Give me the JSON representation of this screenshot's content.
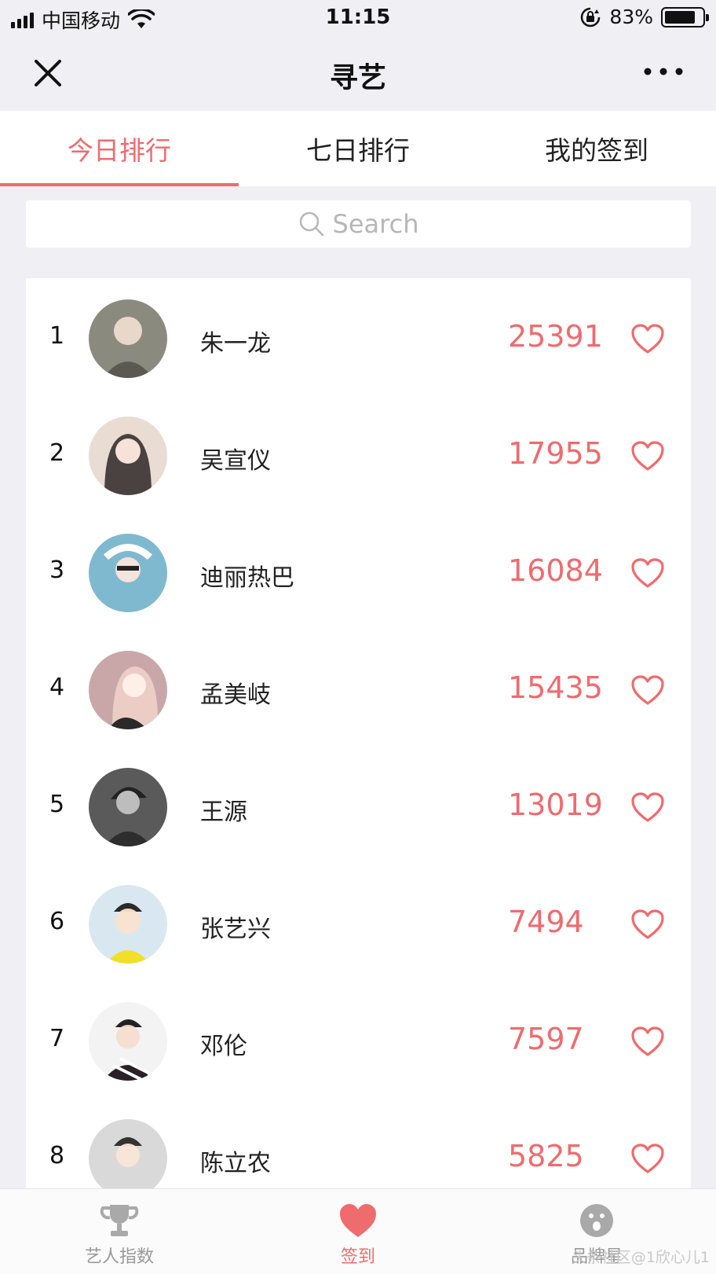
{
  "status_bar": {
    "carrier": "中国移动",
    "time": "11:15",
    "battery_percent": "83%",
    "battery_level": 0.83
  },
  "nav": {
    "title": "寻艺",
    "close_icon": "close-icon",
    "more_icon": "more-icon"
  },
  "tabs": [
    {
      "label": "今日排行",
      "active": true
    },
    {
      "label": "七日排行",
      "active": false
    },
    {
      "label": "我的签到",
      "active": false
    }
  ],
  "search": {
    "placeholder": "Search"
  },
  "ranking": [
    {
      "rank": "1",
      "name": "朱一龙",
      "score": "25391",
      "avatar_color": "#8b8a7e"
    },
    {
      "rank": "2",
      "name": "吴宣仪",
      "score": "17955",
      "avatar_color": "#e9dcd2"
    },
    {
      "rank": "3",
      "name": "迪丽热巴",
      "score": "16084",
      "avatar_color": "#7fb9cf"
    },
    {
      "rank": "4",
      "name": "孟美岐",
      "score": "15435",
      "avatar_color": "#c9a7a8"
    },
    {
      "rank": "5",
      "name": "王源",
      "score": "13019",
      "avatar_color": "#5a5a5a"
    },
    {
      "rank": "6",
      "name": "张艺兴",
      "score": "7494",
      "avatar_color": "#d7d23e"
    },
    {
      "rank": "7",
      "name": "邓伦",
      "score": "7597",
      "avatar_color": "#6e5e61"
    },
    {
      "rank": "8",
      "name": "陈立农",
      "score": "5825",
      "avatar_color": "#d9d9d9"
    }
  ],
  "tab_bar": [
    {
      "label": "艺人指数",
      "icon": "trophy-icon",
      "active": false
    },
    {
      "label": "签到",
      "icon": "heart-icon",
      "active": true
    },
    {
      "label": "品牌星",
      "icon": "face-icon",
      "active": false
    }
  ],
  "watermark": "头条社区@1欣心儿1",
  "colors": {
    "accent": "#ee6b6e",
    "background": "#efeff4",
    "inactive": "#999999"
  }
}
